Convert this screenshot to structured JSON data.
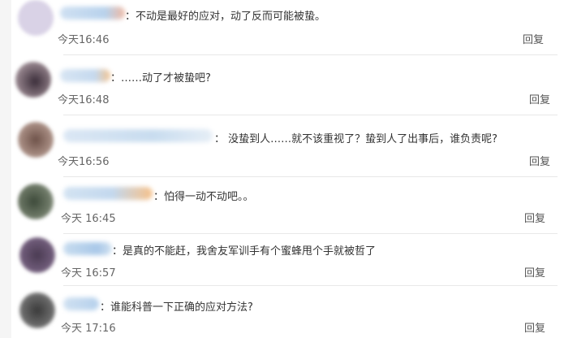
{
  "comments": [
    {
      "text": "：不动是最好的应对，动了反而可能被蛰。",
      "time": "今天16:46",
      "reply": "回复",
      "avatar_color": "#d9d2e6",
      "name_color": "#b8d2ec"
    },
    {
      "text": "：……动了才被蛰吧?",
      "time": "今天16:48",
      "reply": "回复",
      "avatar_color": "#7a6b73",
      "name_color": "#c5d9ee"
    },
    {
      "text": "： 没蛰到人……就不该重视了？蛰到人了出事后，谁负责呢?",
      "time": "今天16:56",
      "reply": "回复",
      "avatar_color": "#a58a80",
      "name_color": "#c8dcef"
    },
    {
      "text": "：怕得一动不动吧。。",
      "time": "今天 16:45",
      "reply": "回复",
      "avatar_color": "#6f7a68",
      "name_color": "#c3d8ee"
    },
    {
      "text": "：是真的不能赶，我舍友军训手有个蜜蜂甩个手就被哲了",
      "time": "今天 16:57",
      "reply": "回复",
      "avatar_color": "#6e5a78",
      "name_color": "#a9c8e8"
    },
    {
      "text": "：谁能科普一下正确的应对方法?",
      "time": "今天 17:16",
      "reply": "回复",
      "avatar_color": "#6a6a6a",
      "name_color": "#b6d1ec"
    }
  ]
}
